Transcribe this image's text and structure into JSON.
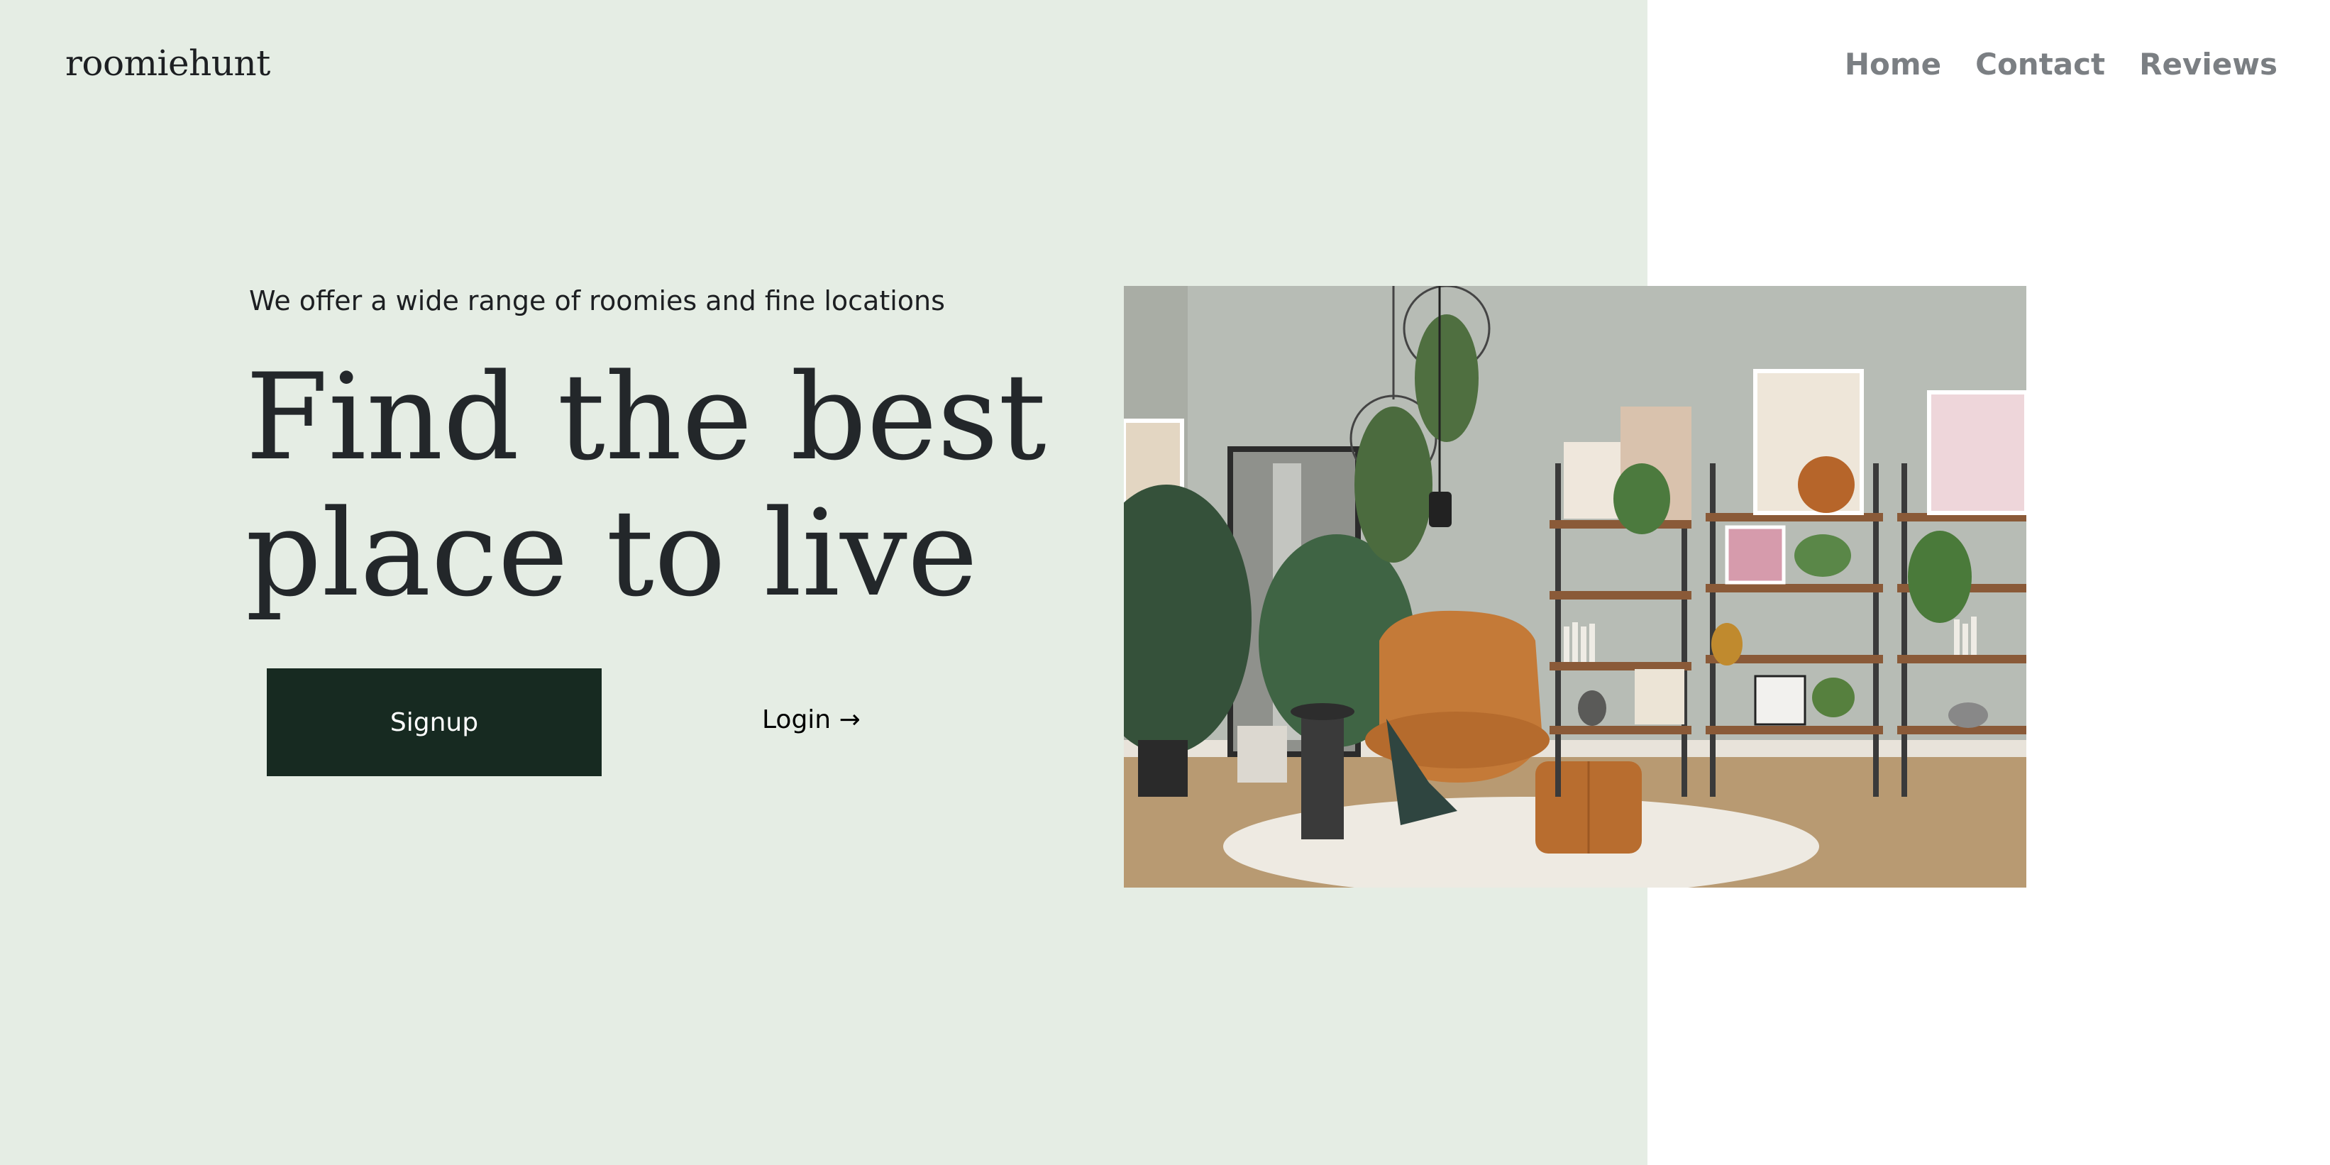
{
  "brand": {
    "name": "roomiehunt"
  },
  "nav": {
    "items": [
      {
        "label": "Home"
      },
      {
        "label": "Contact"
      },
      {
        "label": "Reviews"
      }
    ]
  },
  "hero": {
    "tagline": "We offer a wide range of roomies and fine locations",
    "headline_line1": "Find the best",
    "headline_line2": "place to live",
    "signup_label": "Signup",
    "login_label": "Login →"
  },
  "colors": {
    "panel_background": "#e5ede4",
    "page_background": "#ffffff",
    "primary_button": "#172a21",
    "nav_text": "#7b7f83",
    "heading_text": "#23272a"
  }
}
